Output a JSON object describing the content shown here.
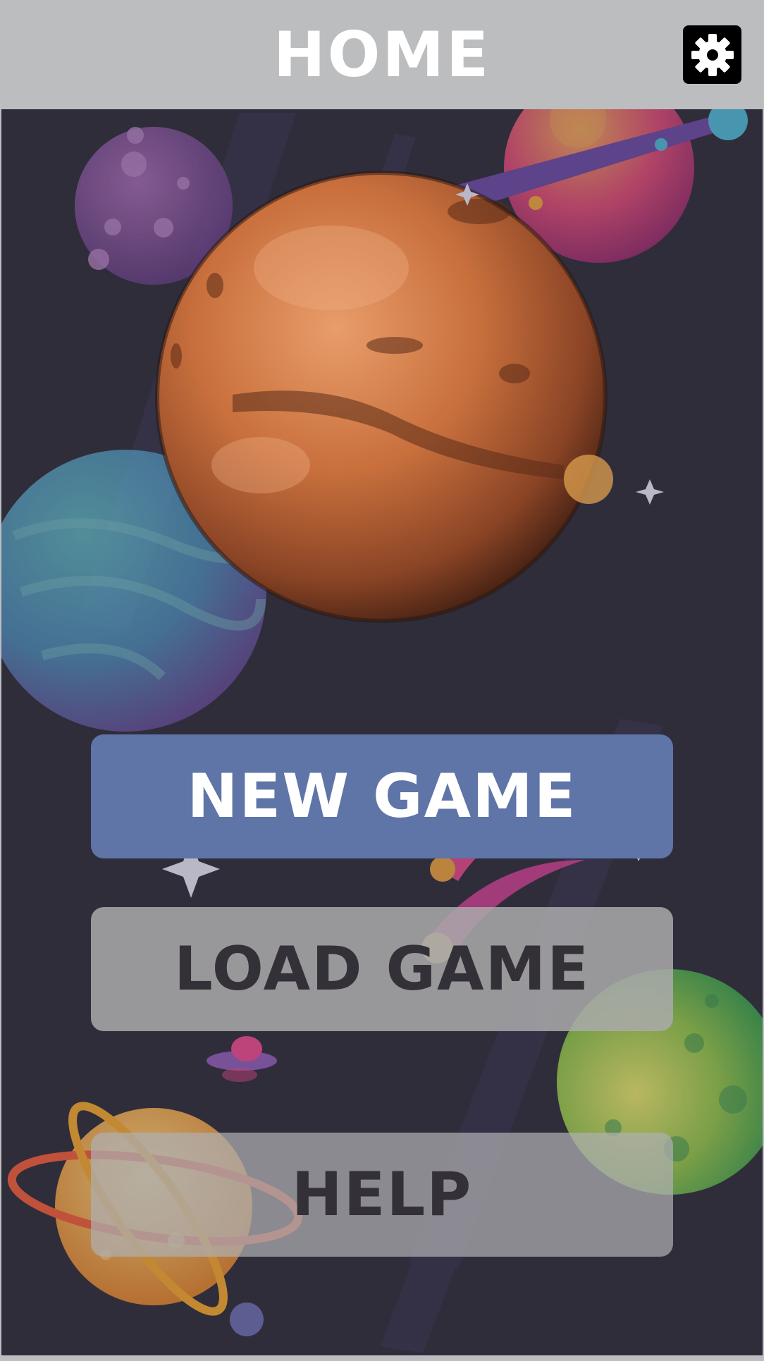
{
  "header": {
    "title": "HOME"
  },
  "icons": {
    "settings": "gear-icon"
  },
  "menu": {
    "new_game": "NEW GAME",
    "load_game": "LOAD GAME",
    "help": "HELP"
  },
  "colors": {
    "header_bg": "#bcbdbf",
    "background": "#302d3b",
    "primary_button": "#5f74a7",
    "secondary_button": "#aaaaac",
    "title_text": "#ffffff",
    "button_dark_text": "#333137"
  }
}
